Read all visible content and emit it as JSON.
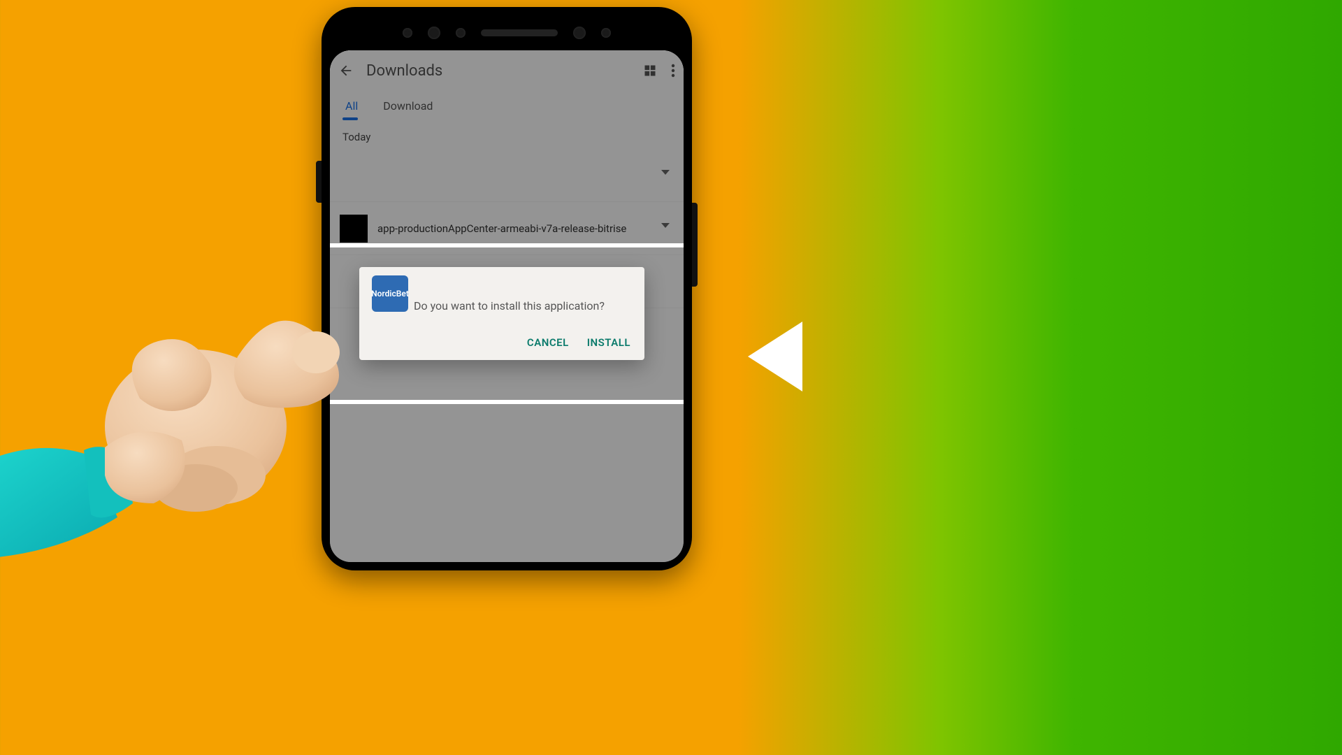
{
  "header": {
    "title": "Downloads"
  },
  "tabs": {
    "all": "All",
    "download": "Download"
  },
  "section": {
    "today": "Today"
  },
  "apk": {
    "filename": "app-productionAppCenter-armeabi-v7a-release-bitrise"
  },
  "dialog": {
    "app_name": "NordicBet",
    "message": "Do you want to install this application?",
    "cancel": "CANCEL",
    "install": "INSTALL"
  }
}
